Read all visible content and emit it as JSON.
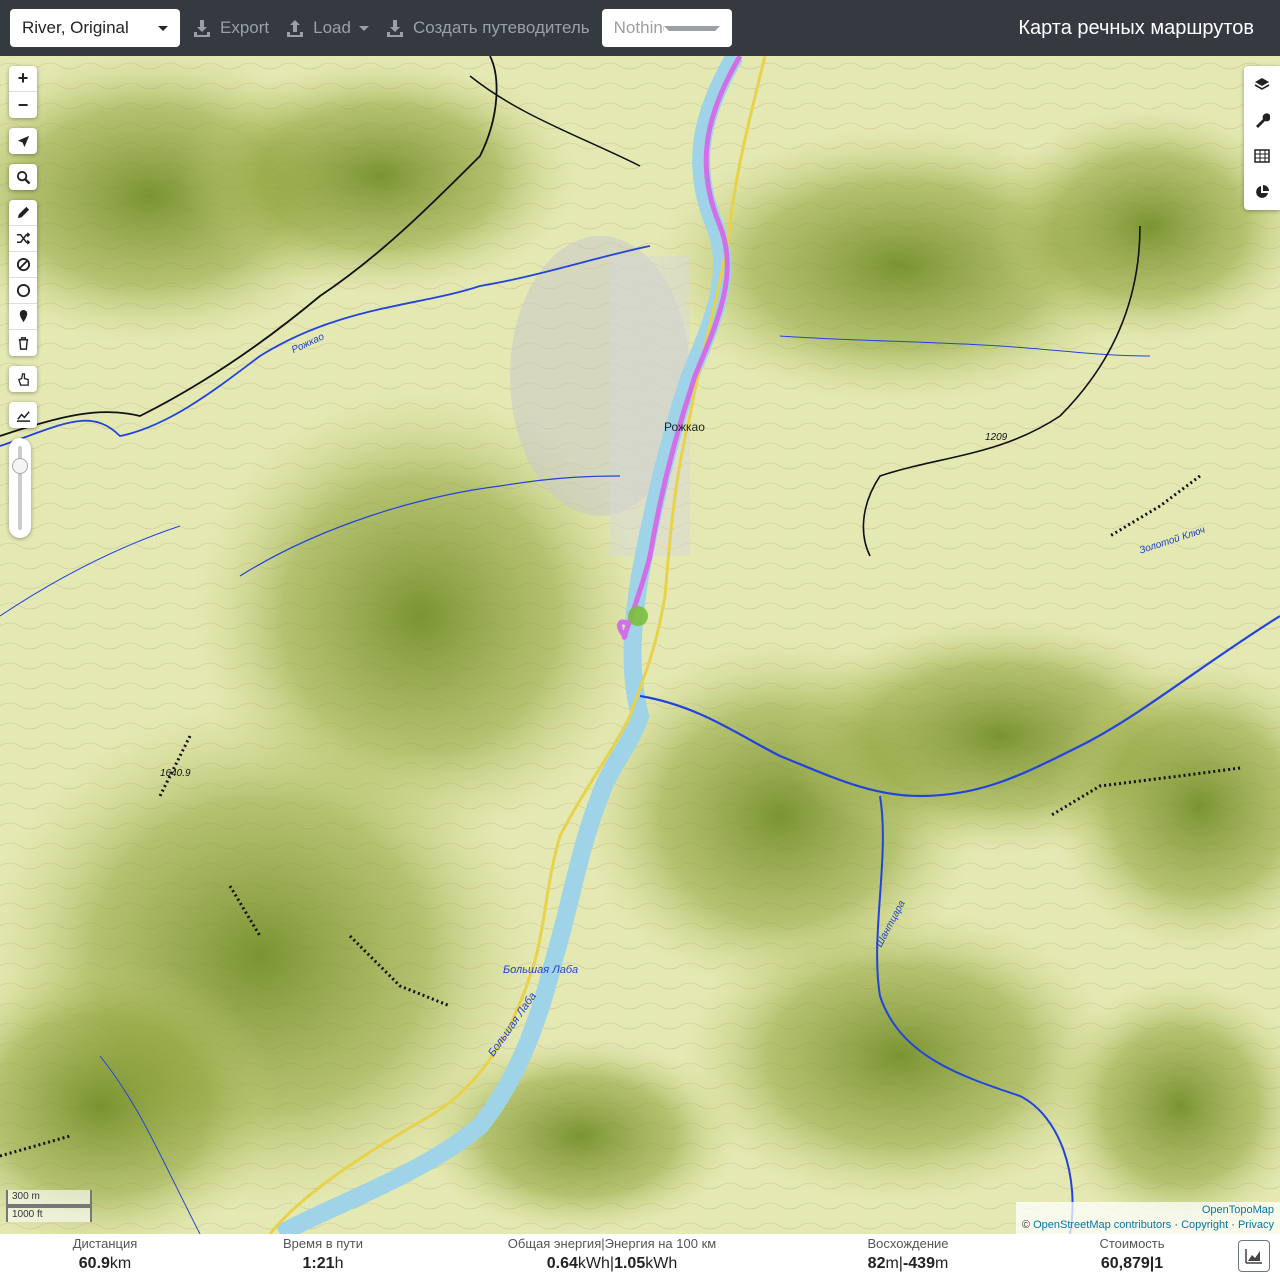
{
  "navbar": {
    "profile": "River, Original",
    "export_label": "Export",
    "load_label": "Load",
    "guide_label": "Создать путеводитель",
    "route_placeholder": "Nothing selected",
    "brand": "Карта речных маршрутов"
  },
  "map_controls": {
    "zoom_in": "+",
    "zoom_out": "−"
  },
  "map_labels": {
    "village": "Рожкао",
    "river_main": "Большая Лаба",
    "river_main2": "Большая Лаба",
    "river_rozhkao": "Рожкао",
    "river_zolotoy": "Золотой Ключ",
    "river_shantsara": "Шантцара",
    "peak1": "1640.9",
    "peak2": "1209"
  },
  "scale": {
    "metric": "300 m",
    "imperial": "1000 ft"
  },
  "attribution": {
    "line1": "OpenTopoMap",
    "copyright_symbol": "©",
    "osm": "OpenStreetMap contributors",
    "sep": "·",
    "copyright": "Copyright",
    "privacy": "Privacy"
  },
  "stats": {
    "distance": {
      "label": "Дистанция",
      "value": "60.9",
      "unit": "km"
    },
    "time": {
      "label": "Время в пути",
      "value": "1:21",
      "unit": "h"
    },
    "energy": {
      "label": "Общая энергия|Энергия на 100 км",
      "value1": "0.64",
      "unit1": "kWh",
      "sep": "|",
      "value2": "1.05",
      "unit2": "kWh"
    },
    "ascent": {
      "label": "Восхождение",
      "value1": "82",
      "unit1": "m",
      "sep": "|",
      "value2": "-439",
      "unit2": "m"
    },
    "cost": {
      "label": "Стоимость",
      "value": "60,879|1"
    }
  },
  "colors": {
    "navbar": "#343a40",
    "route": "#d36fe6",
    "river": "#9fd3e8",
    "road": "#e8d24a"
  }
}
